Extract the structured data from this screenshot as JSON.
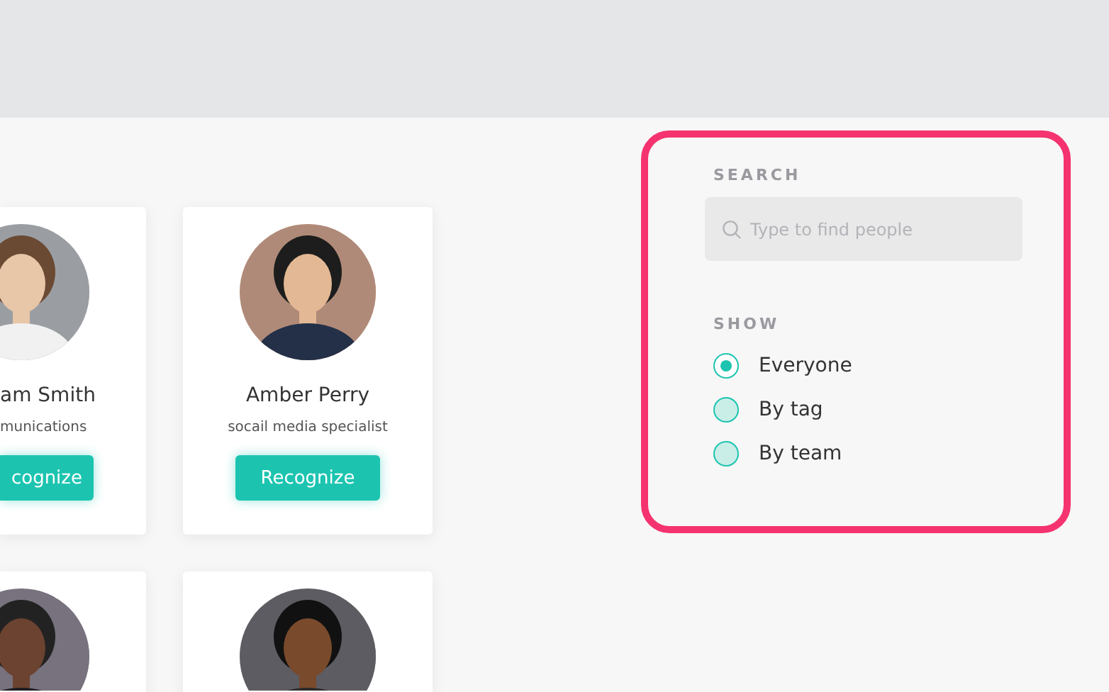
{
  "people": [
    {
      "clipped": true,
      "name": "am Smith",
      "role": "munications",
      "button": "cognize"
    },
    {
      "clipped": false,
      "name": "Amber Perry",
      "role": "socail media specialist",
      "button": "Recognize"
    },
    {
      "clipped": true
    },
    {
      "clipped": false
    }
  ],
  "search": {
    "label": "SEARCH",
    "placeholder": "Type to find people"
  },
  "show": {
    "label": "SHOW",
    "options": [
      {
        "label": "Everyone",
        "selected": true
      },
      {
        "label": "By tag",
        "selected": false
      },
      {
        "label": "By team",
        "selected": false
      }
    ]
  }
}
